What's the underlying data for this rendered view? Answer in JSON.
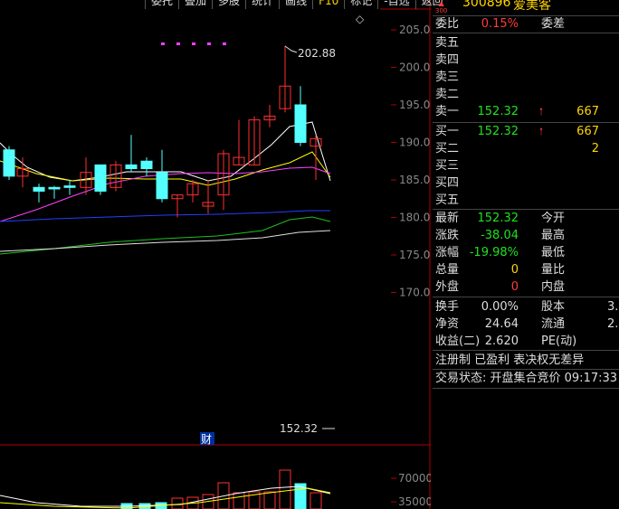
{
  "toolbar": {
    "items": [
      "委托",
      "叠加",
      "多股",
      "统计",
      "画线",
      "F10",
      "标记",
      "-自选",
      "返回"
    ],
    "active_index": 5
  },
  "chart": {
    "price_axis": [
      "205.0",
      "200.0",
      "195.0",
      "190.0",
      "185.0",
      "180.0",
      "175.0",
      "170.0"
    ],
    "max_label": "202.88",
    "last_price_label": "152.32",
    "finance_marker": "财",
    "volume_axis": [
      "70000",
      "35000"
    ],
    "colors": {
      "up": "#ff3030",
      "down": "#54ffff",
      "ma5": "#ffffff",
      "ma10": "#ffff00",
      "ma20": "#ff40ff",
      "ma60": "#2040ff",
      "ma120": "#20c020",
      "ma250": "#e0e0e0"
    }
  },
  "quote": {
    "logo": "300",
    "code": "300896",
    "name": "爱美客",
    "weibi_label": "委比",
    "weibi_value": "0.15%",
    "weicha_label": "委差",
    "sell": [
      {
        "label": "卖五"
      },
      {
        "label": "卖四"
      },
      {
        "label": "卖三"
      },
      {
        "label": "卖二"
      },
      {
        "label": "卖一",
        "price": "152.32",
        "vol": "667"
      }
    ],
    "buy": [
      {
        "label": "买一",
        "price": "152.32",
        "vol": "667"
      },
      {
        "label": "买二",
        "vol": "2"
      },
      {
        "label": "买三"
      },
      {
        "label": "买四"
      },
      {
        "label": "买五"
      }
    ],
    "stats": [
      {
        "l1": "最新",
        "v1": "152.32",
        "l2": "今开"
      },
      {
        "l1": "涨跌",
        "v1": "-38.04",
        "l2": "最高"
      },
      {
        "l1": "涨幅",
        "v1": "-19.98%",
        "l2": "最低"
      },
      {
        "l1": "总量",
        "v1": "0",
        "l2": "量比"
      },
      {
        "l1": "外盘",
        "v1": "0",
        "l2": "内盘"
      }
    ],
    "fund": [
      {
        "l1": "换手",
        "v1": "0.00%",
        "l2": "股本",
        "v2": "3."
      },
      {
        "l1": "净资",
        "v1": "24.64",
        "l2": "流通",
        "v2": "2."
      },
      {
        "l1": "收益(二)",
        "v1": "2.620",
        "l2": "PE(动)",
        "v2": ""
      }
    ],
    "tags": "注册制 已盈利 表决权无差异",
    "trade_status": "交易状态: 开盘集合竞价 09:17:33"
  }
}
